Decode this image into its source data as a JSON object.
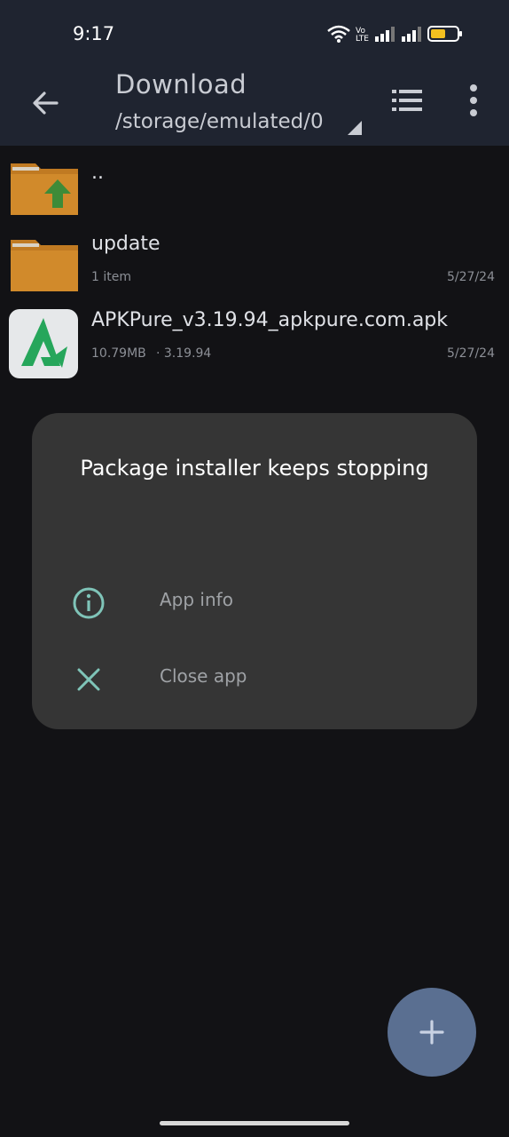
{
  "status_bar": {
    "time": "9:17",
    "volte": "Vo",
    "lte": "LTE",
    "icons": [
      "wifi-icon",
      "volte-icon",
      "signal-icon",
      "signal-icon-2",
      "battery-icon"
    ]
  },
  "app_bar": {
    "title": "Download",
    "path": "/storage/emulated/0",
    "icons": [
      "back-arrow-icon",
      "list-view-icon",
      "more-vert-icon"
    ]
  },
  "files": [
    {
      "name": "..",
      "icon": "folder-up-icon"
    },
    {
      "name": "update",
      "meta": "1 item",
      "date": "5/27/24",
      "icon": "folder-icon"
    },
    {
      "name": "APKPure_v3.19.94_apkpure.com.apk",
      "size": "10.79MB",
      "version": "· 3.19.94",
      "date": "5/27/24",
      "icon": "apkpure-app-icon"
    }
  ],
  "dialog": {
    "title": "Package installer keeps stopping",
    "options": [
      {
        "label": "App info",
        "icon": "info-icon"
      },
      {
        "label": "Close app",
        "icon": "close-icon"
      }
    ]
  },
  "fab": {
    "icon": "plus-icon"
  },
  "colors": {
    "background": "#121215",
    "bar": "#1f2430",
    "dialog": "#353535",
    "accent_teal": "#7fc4b8",
    "fab": "#5a6f91",
    "folder": "#c07a22"
  }
}
